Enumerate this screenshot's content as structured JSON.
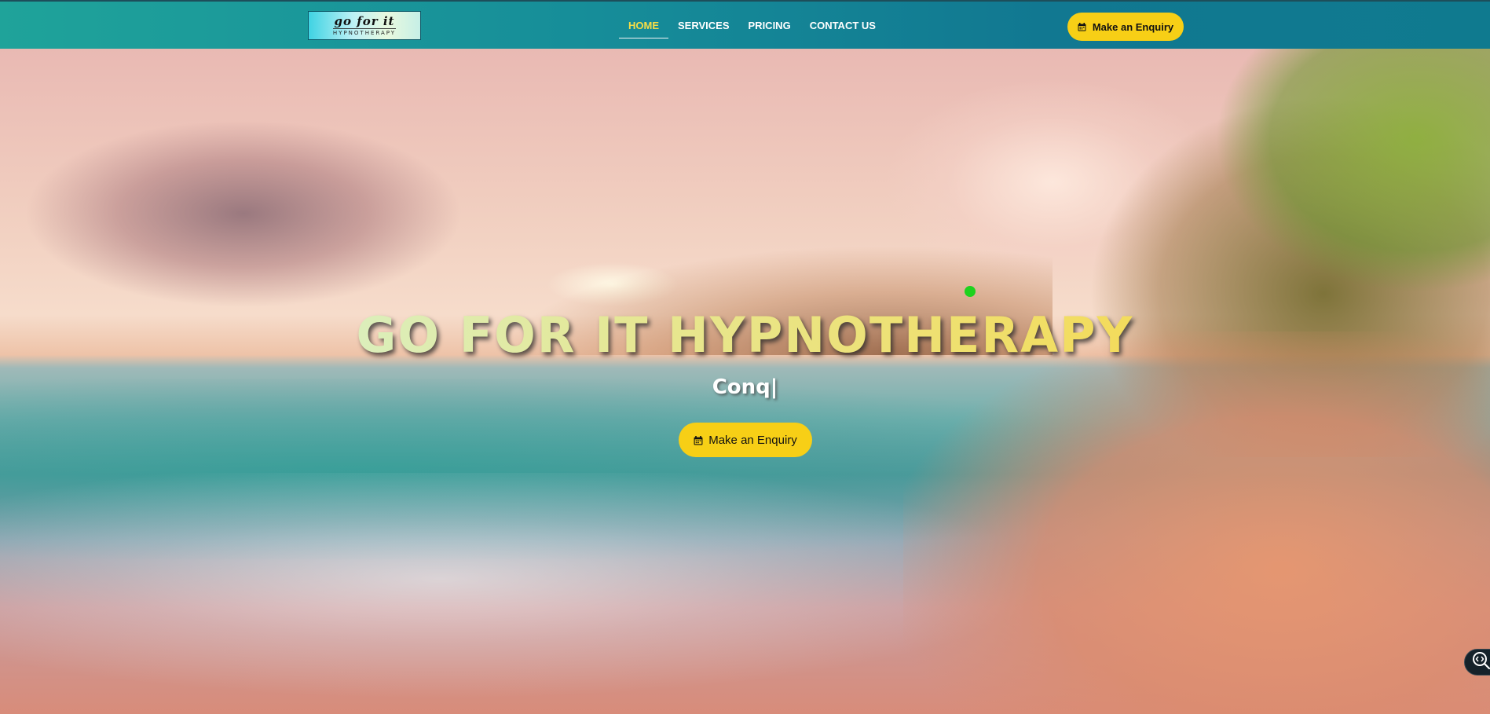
{
  "header": {
    "logo": {
      "script_text": "go for it",
      "subtitle": "HYPNOTHERAPY"
    },
    "nav": [
      {
        "label": "HOME",
        "active": true
      },
      {
        "label": "SERVICES",
        "active": false
      },
      {
        "label": "PRICING",
        "active": false
      },
      {
        "label": "CONTACT US",
        "active": false
      }
    ],
    "cta_label": "Make an Enquiry",
    "cta_icon": "calendar-icon"
  },
  "hero": {
    "title": "GO FOR IT HYPNOTHERAPY",
    "typed_text": "Conq|",
    "cta_label": "Make an Enquiry",
    "cta_icon": "calendar-icon"
  },
  "floating_button": {
    "icon": "code-search-icon"
  },
  "colors": {
    "header_gradient_start": "#1fa39a",
    "header_gradient_end": "#0f7a8f",
    "accent_yellow": "#f7cf16",
    "nav_active": "#f6dd46",
    "cursor_dot": "#1ed21e"
  }
}
